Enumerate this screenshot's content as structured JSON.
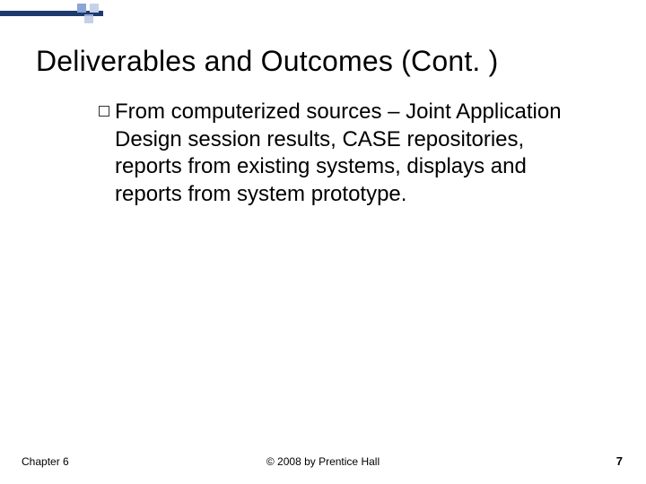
{
  "slide": {
    "title": "Deliverables and Outcomes (Cont. )",
    "bullet": {
      "lead": "From",
      "rest": " computerized sources – Joint Application Design session results, CASE repositories, reports from existing systems, displays and reports from system prototype."
    },
    "footer": {
      "left": "Chapter 6",
      "center": "© 2008 by Prentice Hall",
      "right": "7"
    }
  }
}
